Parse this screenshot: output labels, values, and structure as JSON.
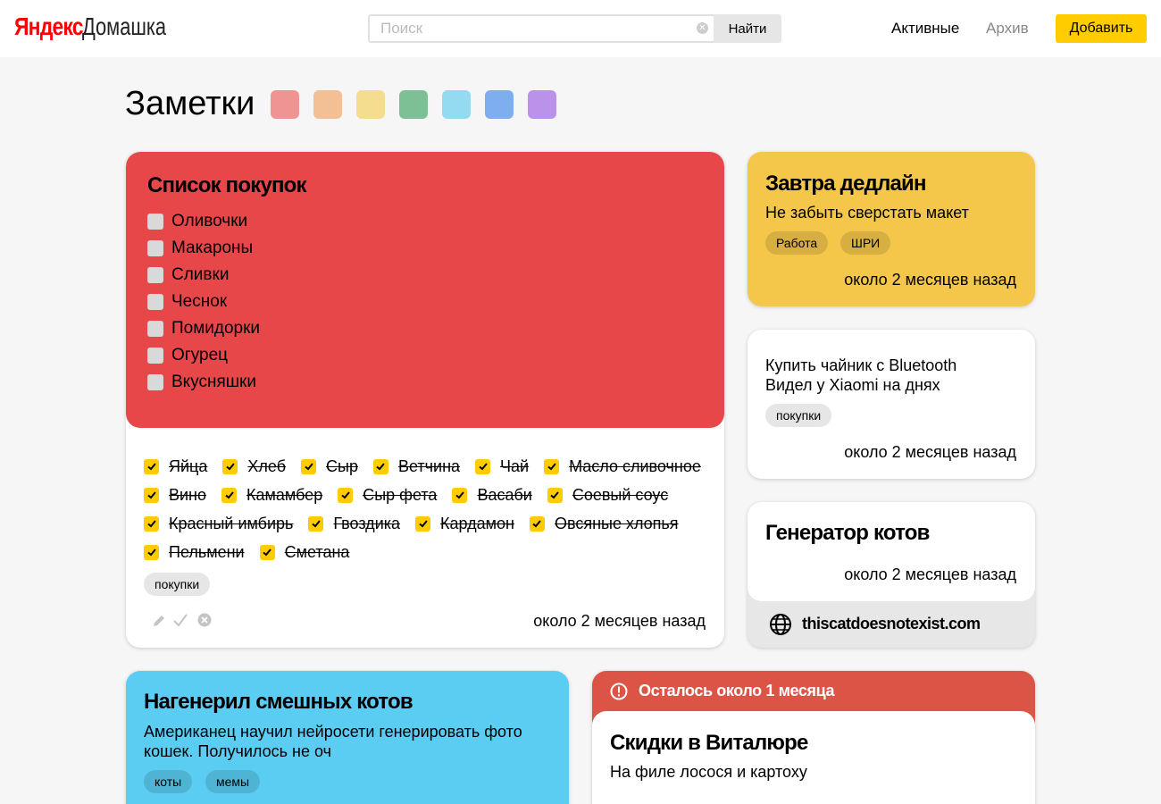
{
  "header": {
    "logo_brand": "Яндекс",
    "logo_service": "Домашка",
    "search_placeholder": "Поиск",
    "search_button": "Найти",
    "nav_active": "Активные",
    "nav_archive": "Архив",
    "add_button": "Добавить"
  },
  "page": {
    "title": "Заметки",
    "colors": [
      "#f09393",
      "#f2c094",
      "#f4dd8e",
      "#7dc096",
      "#94dbf2",
      "#7ead f0",
      "#bb92ea"
    ]
  },
  "shopping": {
    "title": "Список покупок",
    "todo": [
      "Оливочки",
      "Макароны",
      "Сливки",
      "Чеснок",
      "Помидорки",
      "Огурец",
      "Вкусняшки"
    ],
    "done_rows": [
      [
        "Яйца",
        "Хлеб",
        "Сыр",
        "Ветчина",
        "Чай",
        "Масло сливочное"
      ],
      [
        "Вино",
        "Камамбер",
        "Сыр фета",
        "Васаби",
        "Соевый соус"
      ],
      [
        "Красный имбирь",
        "Гвоздика",
        "Кардамон",
        "Овсяные хлопья"
      ],
      [
        "Пельмени",
        "Сметана"
      ]
    ],
    "tag": "покупки",
    "time": "около 2 месяцев назад"
  },
  "deadline": {
    "title": "Завтра дедлайн",
    "text": "Не забыть сверстать макет",
    "tags": [
      "Работа",
      "ШРИ"
    ],
    "time": "около 2 месяцев назад"
  },
  "kettle": {
    "line1": "Купить чайник с Bluetooth",
    "line2": "Видел у Xiaomi на днях",
    "tag": "покупки",
    "time": "около 2 месяцев назад"
  },
  "cats_gen": {
    "title": "Генератор котов",
    "time": "около 2 месяцев назад",
    "link": "thiscatdoesnotexist.com"
  },
  "funny_cats": {
    "title": "Нагенерил смешных котов",
    "text": "Американец научил нейросети генерировать фото кошек. Получилось не оч",
    "tags": [
      "коты",
      "мемы"
    ]
  },
  "discount": {
    "reminder": "Осталось около 1 месяца",
    "title": "Скидки в Виталюре",
    "text": "На филе лосося и картоху"
  }
}
